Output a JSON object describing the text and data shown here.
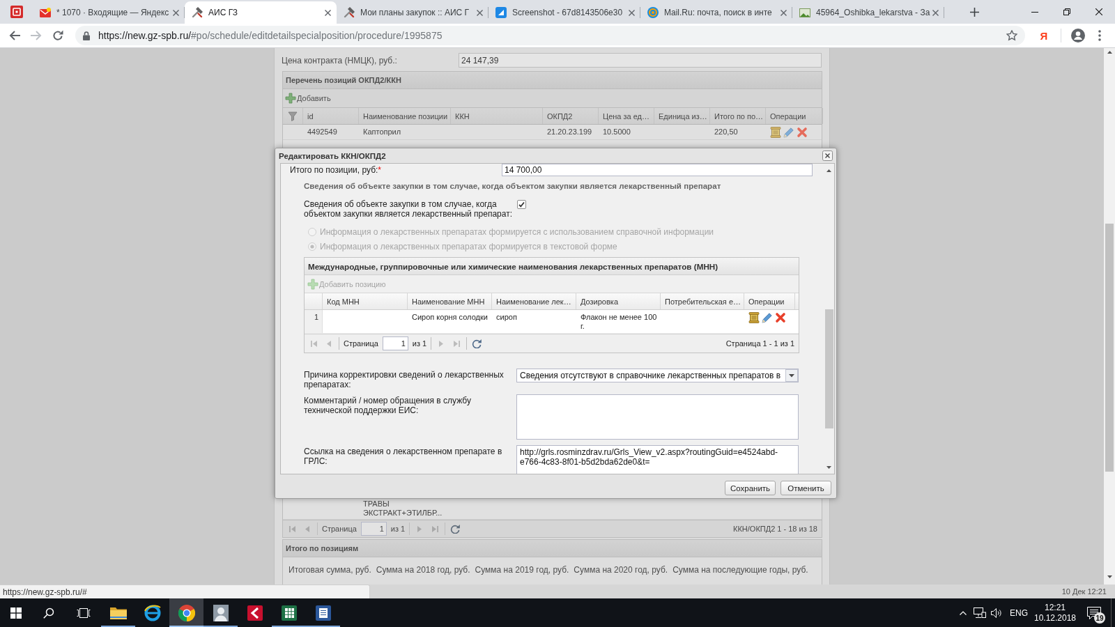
{
  "browser": {
    "tabs": [
      {
        "title": "* 1070 · Входящие — Яндекс",
        "kind": "mail",
        "selected": false
      },
      {
        "title": "АИС ГЗ",
        "kind": "tools",
        "selected": true
      },
      {
        "title": "Мои планы закупок :: АИС Г",
        "kind": "tools",
        "selected": false
      },
      {
        "title": "Screenshot - 67d8143506e30",
        "kind": "screenshot",
        "selected": false
      },
      {
        "title": "Mail.Ru: почта, поиск в инте",
        "kind": "mailru",
        "selected": false
      },
      {
        "title": "45964_Oshibka_lekarstva - За",
        "kind": "image",
        "selected": false
      }
    ],
    "url": {
      "host": "https://new.gz-spb.ru/",
      "path": "#po/schedule/editdetailspecialposition/procedure/1995875"
    },
    "extension": "Я"
  },
  "page": {
    "contract_price": {
      "label": "Цена контракта (НМЦК), руб.:",
      "value": "24 147,39"
    },
    "positions": {
      "title": "Перечень позиций ОКПД2/ККН",
      "add_button": {
        "label": "Добавить",
        "disabled": false
      },
      "columns": [
        "id",
        "Наименование позиции",
        "ККН",
        "ОКПД2",
        "Цена за ед…",
        "Единица из…",
        "Итого по по…",
        "Операции"
      ],
      "rows": [
        {
          "id": "4492549",
          "name": "Каптоприл",
          "okpd2": "21.20.23.199",
          "price": "10.5000",
          "total": "220,50",
          "actions": true
        },
        {
          "name": "ТРАВЫ ЭКСТРАКТ+ЭТИЛБР..."
        }
      ],
      "pager": {
        "nav": [
          {
            "kind": "first",
            "disabled": true
          },
          {
            "kind": "prev",
            "disabled": true
          },
          {
            "kind": "next",
            "disabled": true
          },
          {
            "kind": "last",
            "disabled": true
          },
          {
            "kind": "refresh",
            "disabled": false
          }
        ],
        "label": "Страница",
        "page": "1",
        "of": "из 1",
        "summary": "ККН/ОКПД2 1 - 18 из 18"
      }
    },
    "totals": {
      "title": "Итого по позициям",
      "labels": [
        "Итоговая сумма, руб.",
        "Сумма на 2018 год, руб.",
        "Сумма на 2019 год, руб.",
        "Сумма на 2020 год, руб.",
        "Сумма на последующие годы, руб."
      ]
    },
    "footer_time": "10 Дек 12:21"
  },
  "dialog": {
    "title": "Редактировать ККН/ОКПД2",
    "total_field": {
      "label": "Итого по позиции, руб:",
      "required_mark": "*",
      "value": "14 700,00"
    },
    "section_title": "Сведения об объекте закупки в том случае, когда объектом закупки является лекарственный препарат",
    "drug_checkbox": {
      "label": "Сведения об объекте закупки в том случае, когда объектом закупки является лекарственный препарат:",
      "checked": true
    },
    "radios": [
      {
        "label": "Информация о лекарственных препаратах формируется с использованием справочной информации",
        "selected": false,
        "disabled": true
      },
      {
        "label": "Информация о лекарственных препаратах формируется в текстовой форме",
        "selected": true,
        "disabled": true
      }
    ],
    "mnn_grid": {
      "title": "Международные, группировочные или химические наименования лекарственных препаратов (МНН)",
      "add_button": {
        "label": "Добавить позицию",
        "disabled": true
      },
      "columns": [
        "Код МНН",
        "Наименование МНН",
        "Наименование лек…",
        "Дозировка",
        "Потребительская е…",
        "Операции"
      ],
      "rows": [
        {
          "number": "1",
          "mnn": "Сироп корня солодки",
          "drug": "сироп",
          "dosage": "Флакон не менее 100 г.",
          "actions": true
        }
      ],
      "pager": {
        "nav": [
          {
            "kind": "first",
            "disabled": true
          },
          {
            "kind": "prev",
            "disabled": true
          },
          {
            "kind": "next",
            "disabled": true
          },
          {
            "kind": "last",
            "disabled": true
          },
          {
            "kind": "refresh",
            "disabled": false
          }
        ],
        "label": "Страница",
        "page": "1",
        "of": "из 1",
        "summary": "Страница 1 - 1 из 1"
      }
    },
    "fields": [
      {
        "kind": "combo",
        "label": "Причина корректировки сведений о лекарственных препаратах:",
        "value": "Сведения отсутствуют в справочнике лекарственных препаратов в"
      },
      {
        "kind": "textarea",
        "label": "Комментарий / номер обращения в службу технической поддержки ЕИС:"
      },
      {
        "kind": "textarea",
        "label": "Ссылка на сведения о лекарственном препарате в ГРЛС:",
        "value": "http://grls.rosminzdrav.ru/Grls_View_v2.aspx?routingGuid=e4524abd-e766-4c83-8f01-b5d2bda62de0&t="
      }
    ],
    "buttons": [
      "Сохранить",
      "Отменить"
    ]
  },
  "status_url": "https://new.gz-spb.ru/#",
  "taskbar": {
    "apps": [
      {
        "kind": "folder",
        "running": true,
        "selected": false
      },
      {
        "kind": "globe",
        "running": false,
        "selected": false
      },
      {
        "kind": "wheel",
        "running": true,
        "selected": true
      },
      {
        "kind": "person",
        "running": true,
        "selected": false
      },
      {
        "kind": "shield",
        "running": false,
        "selected": false
      },
      {
        "kind": "sheet",
        "running": true,
        "selected": false
      },
      {
        "kind": "doc",
        "running": true,
        "selected": false
      }
    ],
    "language": "ENG",
    "time": "12:21",
    "date": "10.12.2018",
    "notifications": "19"
  }
}
